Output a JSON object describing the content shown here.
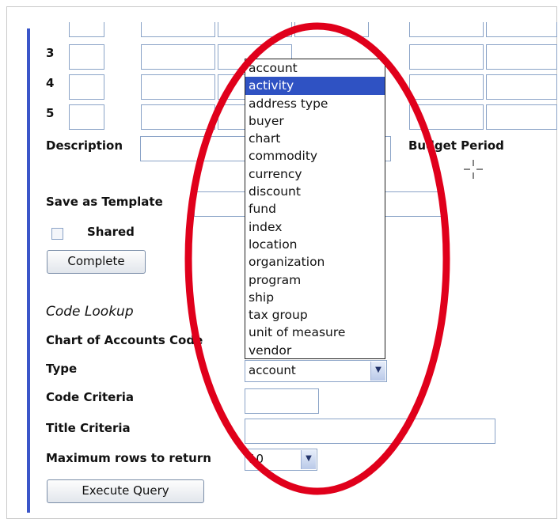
{
  "rows": {
    "numbers": [
      "3",
      "4",
      "5"
    ]
  },
  "fields": {
    "description_label": "Description",
    "budget_period_label": "Budget Period",
    "save_template_label": "Save as Template",
    "shared_label": "Shared",
    "complete_button": "Complete"
  },
  "code_lookup": {
    "heading": "Code Lookup",
    "chart_label": "Chart of Accounts Code",
    "type_label": "Type",
    "type_value": "account",
    "code_criteria_label": "Code Criteria",
    "title_criteria_label": "Title Criteria",
    "max_rows_label": "Maximum rows to return",
    "max_rows_value": "10",
    "execute_button": "Execute Query"
  },
  "dropdown": {
    "selected_index": 1,
    "options": [
      "account",
      "activity",
      "address type",
      "buyer",
      "chart",
      "commodity",
      "currency",
      "discount",
      "fund",
      "index",
      "location",
      "organization",
      "program",
      "ship",
      "tax group",
      "unit of measure",
      "vendor"
    ]
  },
  "colors": {
    "highlight_ellipse": "#e0001b",
    "selected_option": "#2f52c3",
    "left_bar": "#3b56c9"
  }
}
